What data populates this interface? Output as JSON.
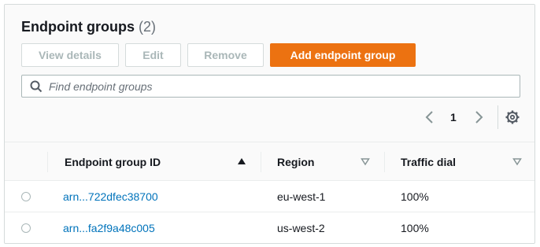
{
  "header": {
    "title": "Endpoint groups",
    "count": "(2)"
  },
  "toolbar": {
    "view_details_label": "View details",
    "edit_label": "Edit",
    "remove_label": "Remove",
    "add_label": "Add endpoint group"
  },
  "search": {
    "placeholder": "Find endpoint groups",
    "value": ""
  },
  "pagination": {
    "current_page": "1"
  },
  "table": {
    "columns": [
      "Endpoint group ID",
      "Region",
      "Traffic dial"
    ],
    "sorted_column": "Endpoint group ID",
    "rows": [
      {
        "id": "arn...722dfec38700",
        "region": "eu-west-1",
        "traffic_dial": "100%"
      },
      {
        "id": "arn...fa2f9a48c005",
        "region": "us-west-2",
        "traffic_dial": "100%"
      }
    ]
  },
  "colors": {
    "primary_button": "#ec7211",
    "link": "#0073bb",
    "disabled_text": "#aab7b8"
  },
  "icons": [
    "search-icon",
    "chevron-left-icon",
    "chevron-right-icon",
    "gear-icon",
    "sort-ascending-icon",
    "sort-descending-icon"
  ]
}
